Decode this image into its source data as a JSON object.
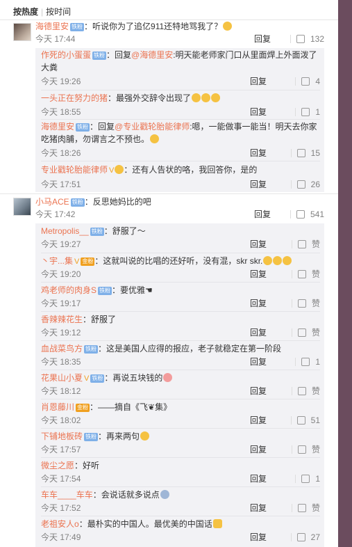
{
  "sort": {
    "hot": "按热度",
    "time": "按时间"
  },
  "threads": [
    {
      "user": "海德里安",
      "badge": "铁粉",
      "text": "：听说你为了追亿911还特地骂我了？",
      "time": "今天 17:44",
      "reply": "回复",
      "likes": "132",
      "replies": [
        {
          "user": "作死的小蛋蛋",
          "badge": "铁粉",
          "pre": "：回复",
          "mention": "@海德里安",
          "text": ":明天能老师家门口从里面焊上外面泼了大粪",
          "time": "今天 19:26",
          "reply": "回复",
          "likes": "4"
        },
        {
          "user": "一头正在努力的猪",
          "text": "：最强外交辞令出现了",
          "time": "今天 18:55",
          "reply": "回复",
          "likes": "1"
        },
        {
          "user": "海德里安",
          "badge": "铁粉",
          "pre": "：回复",
          "mention": "@专业戳轮胎能律师",
          "text": ":嗯，一能做事一能当！明天去你家吃猪肉脯，勿谓言之不预也。",
          "time": "今天 18:26",
          "reply": "回复",
          "likes": "15"
        },
        {
          "user": "专业戳轮胎能律师",
          "vip": "V",
          "text": "：还有人告状的咯，我回答你，是的",
          "time": "今天 17:51",
          "reply": "回复",
          "likes": "26"
        }
      ]
    },
    {
      "user": "小马ACE",
      "badge": "铁粉",
      "text": "：反思她妈比的吧",
      "time": "今天 17:42",
      "reply": "回复",
      "likes": "541",
      "replies": [
        {
          "user": "Metropolis__",
          "badge": "铁粉",
          "text": "：舒服了～",
          "time": "今天 19:27",
          "reply": "回复",
          "likes": "赞"
        },
        {
          "user": "丶宇...集",
          "vip": "V",
          "gold": "金粉",
          "text": "：这就叫说的比唱的还好听，没有混，skr skr.",
          "time": "今天 19:20",
          "reply": "回复",
          "likes": "赞"
        },
        {
          "user": "鸡老师的肉身S",
          "badge": "铁粉",
          "text": "：要优雅",
          "time": "今天 19:17",
          "reply": "回复",
          "likes": "赞"
        },
        {
          "user": "香辣辣花生",
          "text": "：舒服了",
          "time": "今天 19:12",
          "reply": "回复",
          "likes": "赞"
        },
        {
          "user": "血战菜鸟方",
          "badge": "铁粉",
          "text": "：这是美国人应得的报应，老子就稳定在第一阶段",
          "time": "今天 18:35",
          "reply": "回复",
          "likes": "1"
        },
        {
          "user": "花果山小夏",
          "vip": "V",
          "badge": "铁粉",
          "text": "：再说五块钱的",
          "time": "今天 18:12",
          "reply": "回复",
          "likes": "赞"
        },
        {
          "user": "肖恩藤川",
          "gold": "金粉",
          "text": "：——摘自《飞❦集》",
          "time": "今天 18:02",
          "reply": "回复",
          "likes": "51"
        },
        {
          "user": "下铺地板砖",
          "badge": "铁粉",
          "text": "：再来两句",
          "time": "今天 17:57",
          "reply": "回复",
          "likes": "赞"
        },
        {
          "user": "微尘之愿",
          "text": "：好听",
          "time": "今天 17:54",
          "reply": "回复",
          "likes": "1"
        },
        {
          "user": "车车____车车",
          "text": "：会说话就多说点",
          "time": "今天 17:52",
          "reply": "回复",
          "likes": "赞"
        },
        {
          "user": "老祖安人o",
          "text": "：最朴实的中国人。最优美的中国话",
          "time": "今天 17:49",
          "reply": "回复",
          "likes": "27"
        }
      ]
    }
  ]
}
